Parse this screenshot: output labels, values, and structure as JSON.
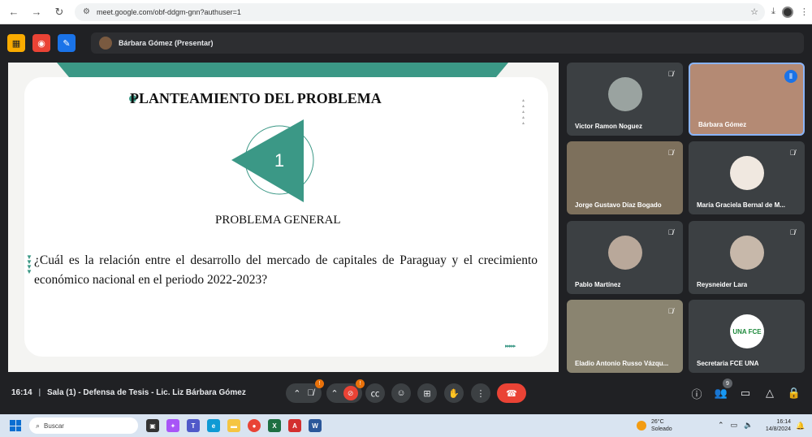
{
  "browser": {
    "url": "meet.google.com/obf-ddgm-gnn?authuser=1"
  },
  "meet": {
    "presenting_label": "Bárbara Gómez (Presentar)"
  },
  "slide": {
    "title": "PLANTEAMIENTO DEL PROBLEMA",
    "number": "1",
    "subtitle": "PROBLEMA GENERAL",
    "question": "¿Cuál es la relación entre el desarrollo del mercado de capitales de Paraguay y el crecimiento económico nacional en el periodo 2022-2023?"
  },
  "participants": [
    {
      "name": "Victor Ramon Noguez",
      "muted": true
    },
    {
      "name": "Bárbara Gómez",
      "muted": false,
      "speaking": true
    },
    {
      "name": "Jorge Gustavo Díaz Bogado",
      "muted": true
    },
    {
      "name": "María Graciela Bernal de M...",
      "muted": true
    },
    {
      "name": "Pablo Martínez",
      "muted": true
    },
    {
      "name": "Reysneider Lara",
      "muted": true
    },
    {
      "name": "Eladio Antonio Russo Vázqu...",
      "muted": true
    },
    {
      "name": "Secretaria FCE UNA",
      "muted": false,
      "logo_text": "UNA FCE"
    }
  ],
  "controls": {
    "time": "16:14",
    "meeting_title": "Sala (1) - Defensa de Tesis - Lic. Liz Bárbara Gómez",
    "mic_badge": "!",
    "cam_badge": "!",
    "people_count": "9"
  },
  "taskbar": {
    "search_placeholder": "Buscar",
    "temperature": "26°C",
    "weather": "Soleado",
    "clock_time": "16:14",
    "clock_date": "14/8/2024"
  },
  "colors": {
    "accent": "#3b9886",
    "end_call": "#ea4335",
    "active_border": "#8ab4f8"
  }
}
